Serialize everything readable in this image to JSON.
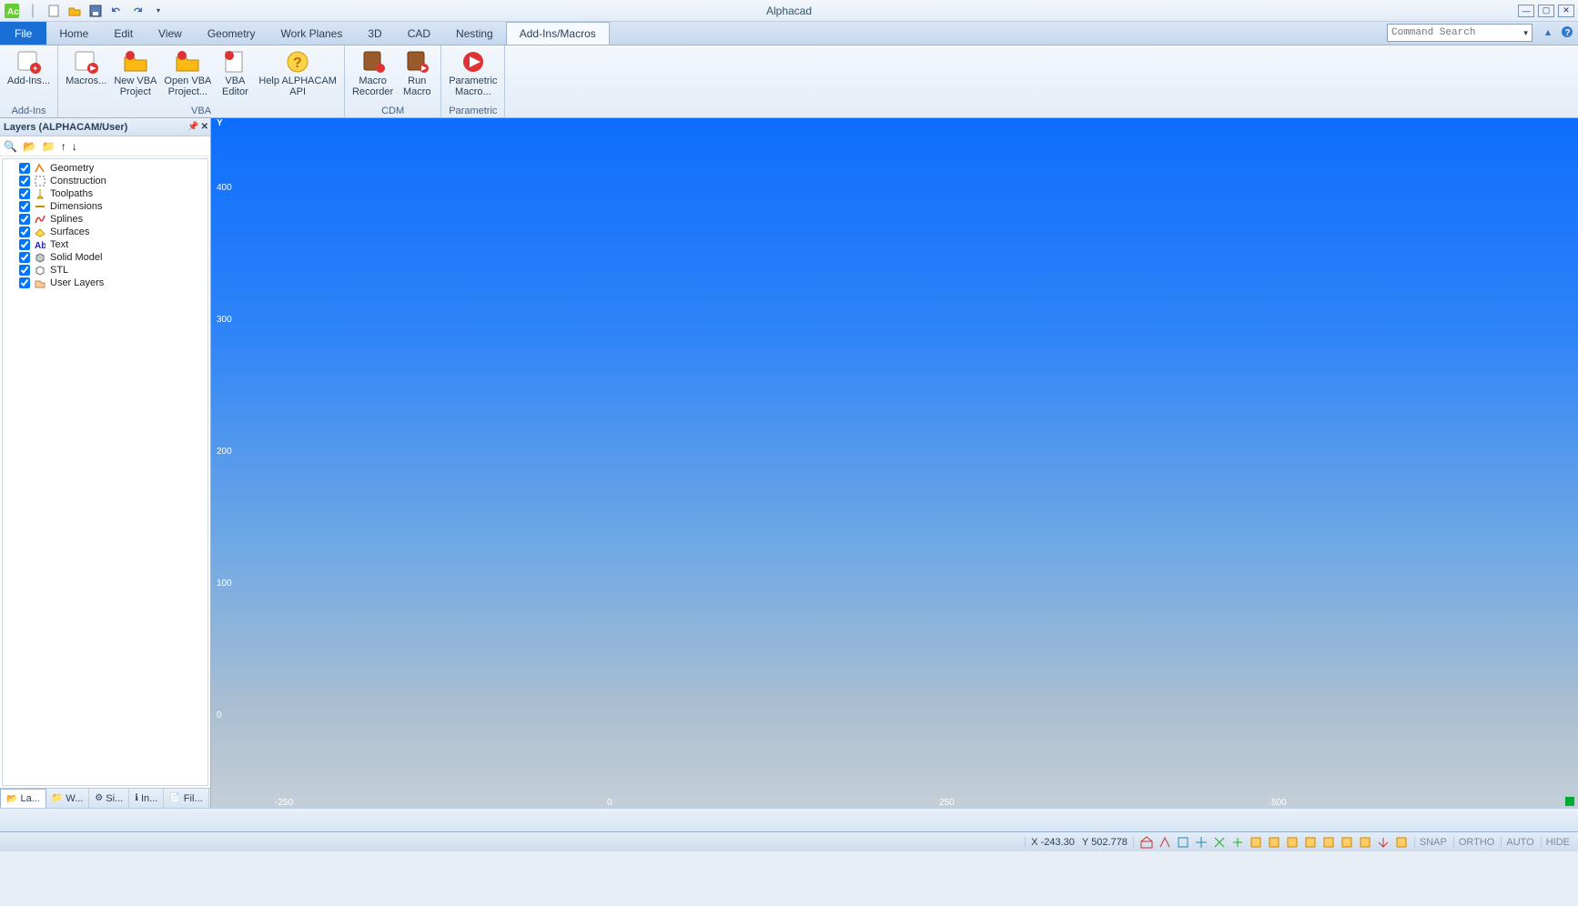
{
  "app_title": "Alphacad",
  "qat_icons": [
    "logo",
    "new",
    "open",
    "save",
    "undo",
    "redo",
    "dropdown"
  ],
  "menu_tabs": [
    "File",
    "Home",
    "Edit",
    "View",
    "Geometry",
    "Work Planes",
    "3D",
    "CAD",
    "Nesting",
    "Add-Ins/Macros"
  ],
  "active_tab": "Add-Ins/Macros",
  "search_placeholder": "Command Search",
  "ribbon": {
    "groups": [
      {
        "name": "Add-Ins",
        "buttons": [
          {
            "id": "addins",
            "label": "Add-Ins..."
          }
        ]
      },
      {
        "name": "VBA",
        "buttons": [
          {
            "id": "macros",
            "label": "Macros..."
          },
          {
            "id": "newvba",
            "label": "New VBA\nProject"
          },
          {
            "id": "openvba",
            "label": "Open VBA\nProject..."
          },
          {
            "id": "vbaeditor",
            "label": "VBA\nEditor"
          },
          {
            "id": "helpapi",
            "label": "Help ALPHACAM\nAPI"
          }
        ]
      },
      {
        "name": "CDM",
        "buttons": [
          {
            "id": "macrorec",
            "label": "Macro\nRecorder"
          },
          {
            "id": "runmacro",
            "label": "Run\nMacro"
          }
        ]
      },
      {
        "name": "Parametric",
        "buttons": [
          {
            "id": "param",
            "label": "Parametric\nMacro..."
          }
        ]
      }
    ]
  },
  "panel": {
    "title": "Layers (ALPHACAM/User)",
    "layers": [
      {
        "name": "Geometry",
        "icon": "geo"
      },
      {
        "name": "Construction",
        "icon": "constr"
      },
      {
        "name": "Toolpaths",
        "icon": "tool"
      },
      {
        "name": "Dimensions",
        "icon": "dim"
      },
      {
        "name": "Splines",
        "icon": "spline"
      },
      {
        "name": "Surfaces",
        "icon": "surf"
      },
      {
        "name": "Text",
        "icon": "text"
      },
      {
        "name": "Solid Model",
        "icon": "solid"
      },
      {
        "name": "STL",
        "icon": "stl"
      },
      {
        "name": "User Layers",
        "icon": "user"
      }
    ],
    "bottom_tabs": [
      {
        "label": "La...",
        "icon": "layers"
      },
      {
        "label": "W...",
        "icon": "work"
      },
      {
        "label": "Si...",
        "icon": "sim"
      },
      {
        "label": "In...",
        "icon": "info"
      },
      {
        "label": "Fil...",
        "icon": "file"
      }
    ]
  },
  "canvas": {
    "y_ticks": [
      "400",
      "300",
      "200",
      "100",
      "0"
    ],
    "x_ticks": [
      "-250",
      "0",
      "250",
      "500"
    ],
    "y_axis_label": "Y"
  },
  "status": {
    "x_label": "X",
    "x_value": "-243.30",
    "y_label": "Y",
    "y_value": "502.778",
    "modes": [
      "SNAP",
      "ORTHO",
      "AUTO",
      "HIDE"
    ]
  }
}
